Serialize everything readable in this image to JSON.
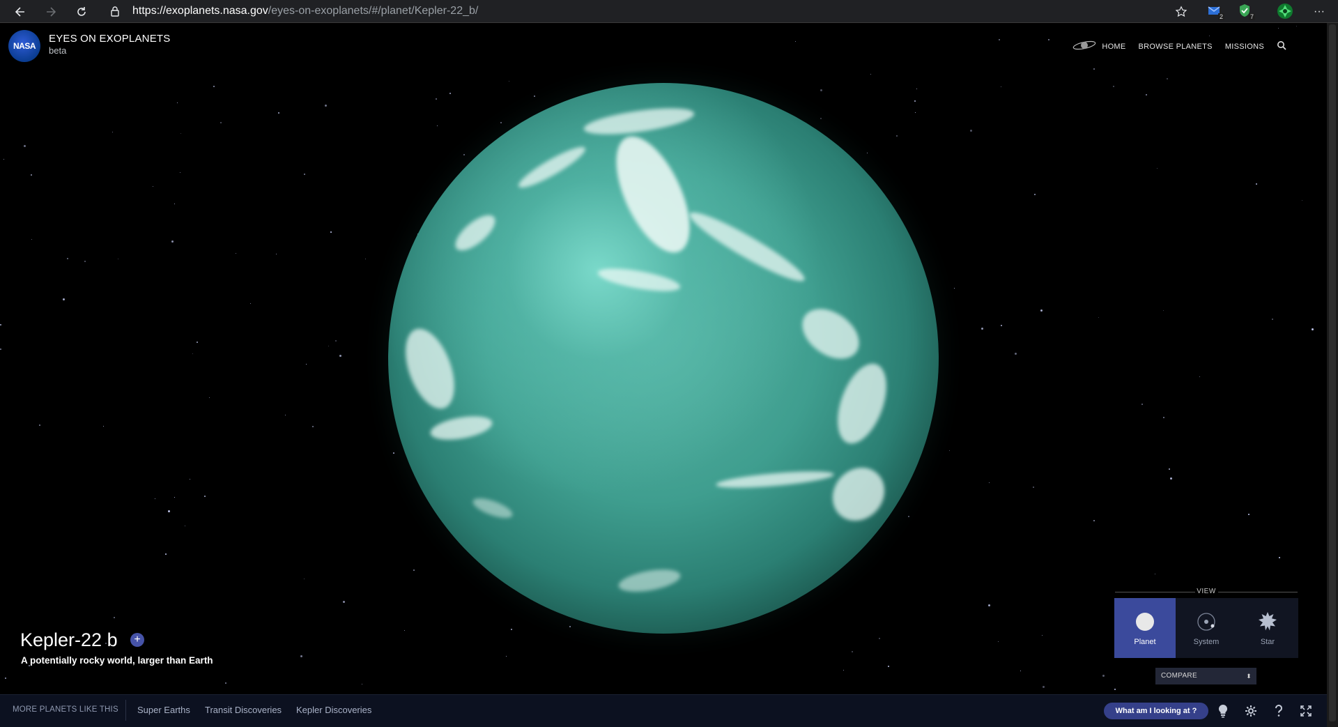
{
  "browser": {
    "url_host": "https://exoplanets.nasa.gov",
    "url_path": "/eyes-on-exoplanets/#/planet/Kepler-22_b/",
    "extensions": [
      {
        "name": "mail-extension-icon",
        "badge": "2"
      },
      {
        "name": "shield-extension-icon",
        "badge": "7"
      },
      {
        "name": "green-logo-extension-icon",
        "badge": ""
      }
    ],
    "menu_glyph": "···"
  },
  "header": {
    "logo_text": "NASA",
    "title": "EYES ON EXOPLANETS",
    "subtitle": "beta",
    "nav": {
      "home": "HOME",
      "browse": "BROWSE PLANETS",
      "missions": "MISSIONS"
    }
  },
  "planet": {
    "name": "Kepler-22 b",
    "add_glyph": "+",
    "description": "A potentially rocky world, larger than Earth"
  },
  "view_panel": {
    "label": "VIEW",
    "options": [
      {
        "label": "Planet",
        "icon": "planet-icon",
        "active": true
      },
      {
        "label": "System",
        "icon": "system-icon",
        "active": false
      },
      {
        "label": "Star",
        "icon": "star-icon",
        "active": false
      }
    ],
    "compare_label": "COMPARE",
    "compare_arrow": "⬍"
  },
  "bottom_bar": {
    "more_label": "MORE PLANETS LIKE THIS",
    "links": [
      "Super Earths",
      "Transit Discoveries",
      "Kepler Discoveries"
    ],
    "help_button": "What am I looking at ?"
  },
  "colors": {
    "accent": "#3b4a9c",
    "bottom_bar": "#0c1120",
    "planet": "#3f9e8f"
  }
}
